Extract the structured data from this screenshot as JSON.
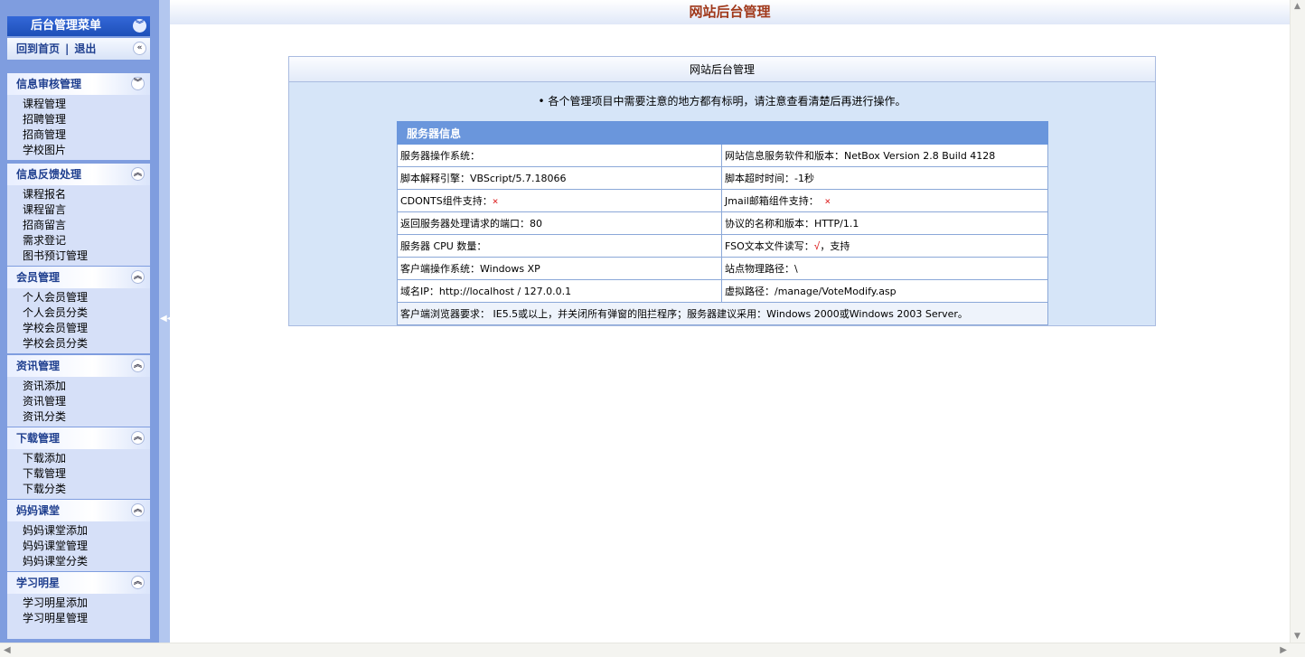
{
  "sidebar": {
    "title": "后台管理菜单",
    "home": "回到首页",
    "sep": "|",
    "logout": "退出",
    "groups": [
      {
        "title": "信息审核管理",
        "items": [
          "课程管理",
          "招聘管理",
          "招商管理",
          "学校图片"
        ]
      },
      {
        "title": "信息反馈处理",
        "items": [
          "课程报名",
          "课程留言",
          "招商留言",
          "需求登记",
          "图书预订管理"
        ]
      },
      {
        "title": "会员管理",
        "items": [
          "个人会员管理",
          "个人会员分类",
          "学校会员管理",
          "学校会员分类"
        ]
      },
      {
        "title": "资讯管理",
        "items": [
          "资讯添加",
          "资讯管理",
          "资讯分类"
        ]
      },
      {
        "title": "下载管理",
        "items": [
          "下载添加",
          "下载管理",
          "下载分类"
        ]
      },
      {
        "title": "妈妈课堂",
        "items": [
          "妈妈课堂添加",
          "妈妈课堂管理",
          "妈妈课堂分类"
        ]
      },
      {
        "title": "学习明星",
        "items": [
          "学习明星添加",
          "学习明星管理"
        ]
      }
    ]
  },
  "main": {
    "page_title": "网站后台管理",
    "panel_title": "网站后台管理",
    "notice": "• 各个管理项目中需要注意的地方都有标明，请注意查看清楚后再进行操作。",
    "server_info_title": "服务器信息",
    "rows": [
      [
        "服务器操作系统：",
        "网站信息服务软件和版本：NetBox Version 2.8 Build 4128"
      ],
      [
        "脚本解释引擎：VBScript/5.7.18066",
        "脚本超时时间：-1秒"
      ],
      [
        "CDONTS组件支持：",
        "Jmail邮箱组件支持："
      ],
      [
        "返回服务器处理请求的端口：80",
        "协议的名称和版本：HTTP/1.1"
      ],
      [
        "服务器 CPU 数量：",
        "FSO文本文件读写："
      ],
      [
        "客户端操作系统：Windows XP",
        "站点物理路径：\\"
      ],
      [
        "域名IP：http://localhost / 127.0.0.1",
        "虚拟路径：/manage/VoteModify.asp"
      ]
    ],
    "cross_mark": "×",
    "tick_mark": "√",
    "fso_support": "，支持",
    "browser_req": "客户端浏览器要求： IE5.5或以上，并关闭所有弹窗的阻拦程序；服务器建议采用：Windows 2000或Windows 2003 Server。"
  },
  "colors": {
    "accent": "#6a96dc",
    "title": "#a0381a",
    "sidebar_bg": "#7f9ddf"
  }
}
